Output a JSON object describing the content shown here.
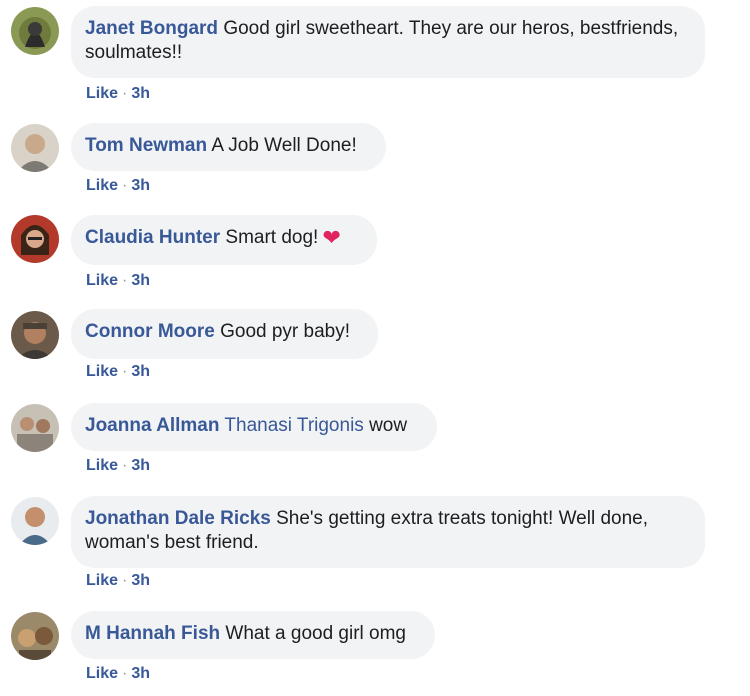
{
  "comments": [
    {
      "author": "Janet Bongard",
      "mention": "",
      "text": "Good girl sweetheart. They are our heros, bestfriends, soulmates!!",
      "emoji": "",
      "like": "Like",
      "separator": "·",
      "time": "3h"
    },
    {
      "author": "Tom Newman",
      "mention": "",
      "text": "A Job Well Done!",
      "emoji": "",
      "like": "Like",
      "separator": "·",
      "time": "3h"
    },
    {
      "author": "Claudia Hunter",
      "mention": "",
      "text": "Smart dog!",
      "emoji": "❤",
      "like": "Like",
      "separator": "·",
      "time": "3h"
    },
    {
      "author": "Connor Moore",
      "mention": "",
      "text": "Good pyr baby!",
      "emoji": "",
      "like": "Like",
      "separator": "·",
      "time": "3h"
    },
    {
      "author": "Joanna Allman",
      "mention": "Thanasi Trigonis",
      "text": "wow",
      "emoji": "",
      "like": "Like",
      "separator": "·",
      "time": "3h"
    },
    {
      "author": "Jonathan Dale Ricks",
      "mention": "",
      "text": "She's getting extra treats tonight! Well done, woman's best friend.",
      "emoji": "",
      "like": "Like",
      "separator": "·",
      "time": "3h"
    },
    {
      "author": "M Hannah Fish",
      "mention": "",
      "text": "What a good girl omg",
      "emoji": "",
      "like": "Like",
      "separator": "·",
      "time": "3h"
    }
  ],
  "colors": {
    "link": "#385898",
    "bubble": "#f2f3f5",
    "heart": "#e0245e"
  }
}
